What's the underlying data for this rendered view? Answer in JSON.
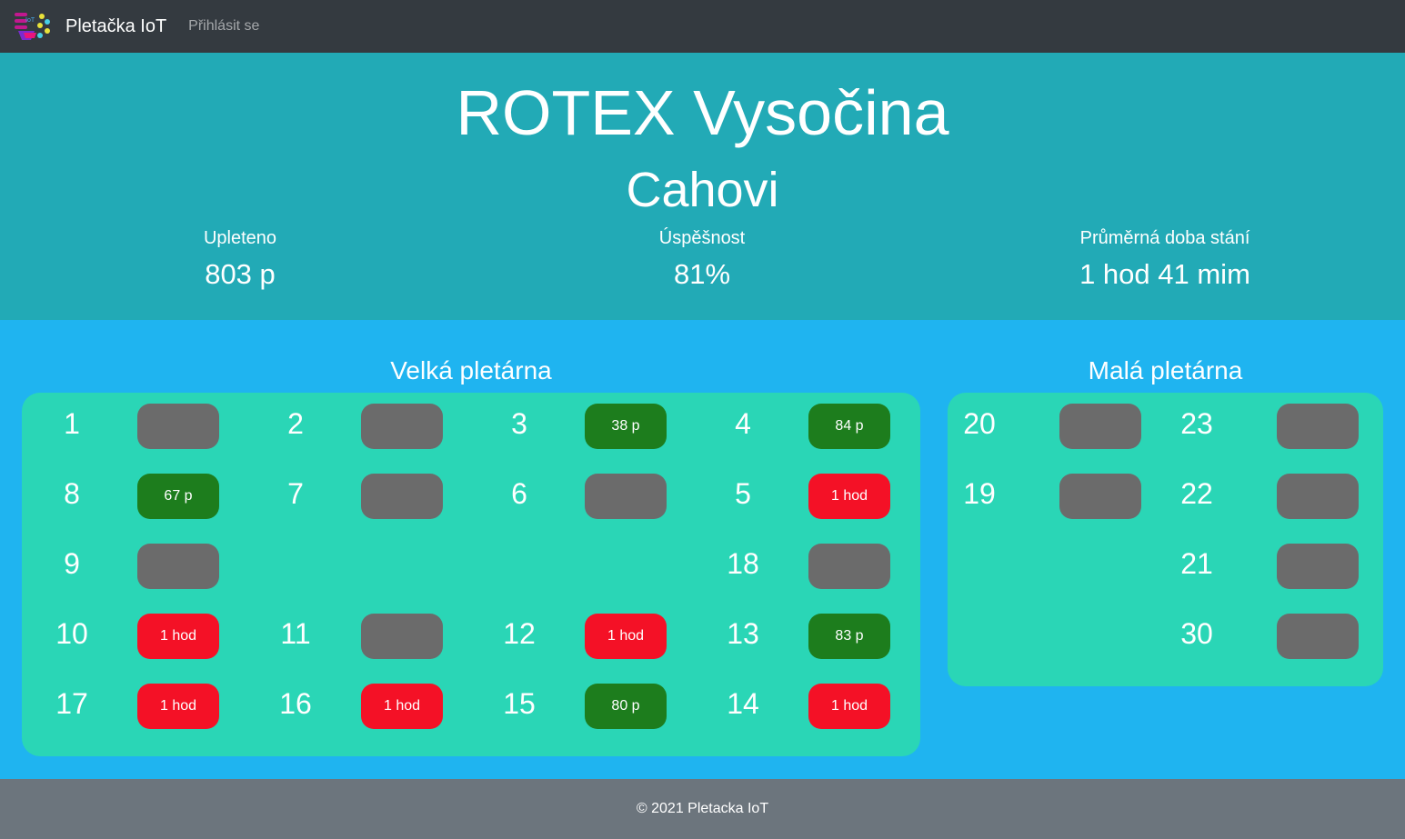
{
  "navbar": {
    "brand": "Pletačka IoT",
    "login_link": "Přihlásit se"
  },
  "hero": {
    "title": "ROTEX Vysočina",
    "subtitle": "Cahovi",
    "stats": [
      {
        "label": "Upleteno",
        "value": "803 p"
      },
      {
        "label": "Úspěšnost",
        "value": "81%"
      },
      {
        "label": "Průměrná doba stání",
        "value": "1 hod 41 mim"
      }
    ]
  },
  "halls": [
    {
      "title": "Velká pletárna",
      "machines": [
        {
          "number": "1",
          "status": "gray",
          "label": ""
        },
        {
          "number": "2",
          "status": "gray",
          "label": ""
        },
        {
          "number": "3",
          "status": "green",
          "label": "38 p"
        },
        {
          "number": "4",
          "status": "green",
          "label": "84 p"
        },
        {
          "number": "8",
          "status": "green",
          "label": "67 p"
        },
        {
          "number": "7",
          "status": "gray",
          "label": ""
        },
        {
          "number": "6",
          "status": "gray",
          "label": ""
        },
        {
          "number": "5",
          "status": "red",
          "label": "1 hod"
        },
        {
          "number": "9",
          "status": "gray",
          "label": ""
        },
        {
          "number": "18",
          "status": "gray",
          "label": ""
        },
        {
          "number": "10",
          "status": "red",
          "label": "1 hod"
        },
        {
          "number": "11",
          "status": "gray",
          "label": ""
        },
        {
          "number": "12",
          "status": "red",
          "label": "1 hod"
        },
        {
          "number": "13",
          "status": "green",
          "label": "83 p"
        },
        {
          "number": "17",
          "status": "red",
          "label": "1 hod"
        },
        {
          "number": "16",
          "status": "red",
          "label": "1 hod"
        },
        {
          "number": "15",
          "status": "green",
          "label": "80 p"
        },
        {
          "number": "14",
          "status": "red",
          "label": "1 hod"
        }
      ]
    },
    {
      "title": "Malá pletárna",
      "machines": [
        {
          "number": "20",
          "status": "gray",
          "label": ""
        },
        {
          "number": "23",
          "status": "gray",
          "label": ""
        },
        {
          "number": "19",
          "status": "gray",
          "label": ""
        },
        {
          "number": "22",
          "status": "gray",
          "label": ""
        },
        {
          "number": "21",
          "status": "gray",
          "label": ""
        },
        {
          "number": "30",
          "status": "gray",
          "label": ""
        }
      ]
    }
  ],
  "footer": {
    "text": "© 2021 Pletacka IoT"
  },
  "colors": {
    "navbar": "#343a40",
    "hero": "#22aab6",
    "main": "#1fb4f0",
    "hall": "#2ad6b6",
    "gray": "#6b6b6b",
    "green": "#1d7d1d",
    "red": "#f41126",
    "footer": "#6c757d"
  }
}
